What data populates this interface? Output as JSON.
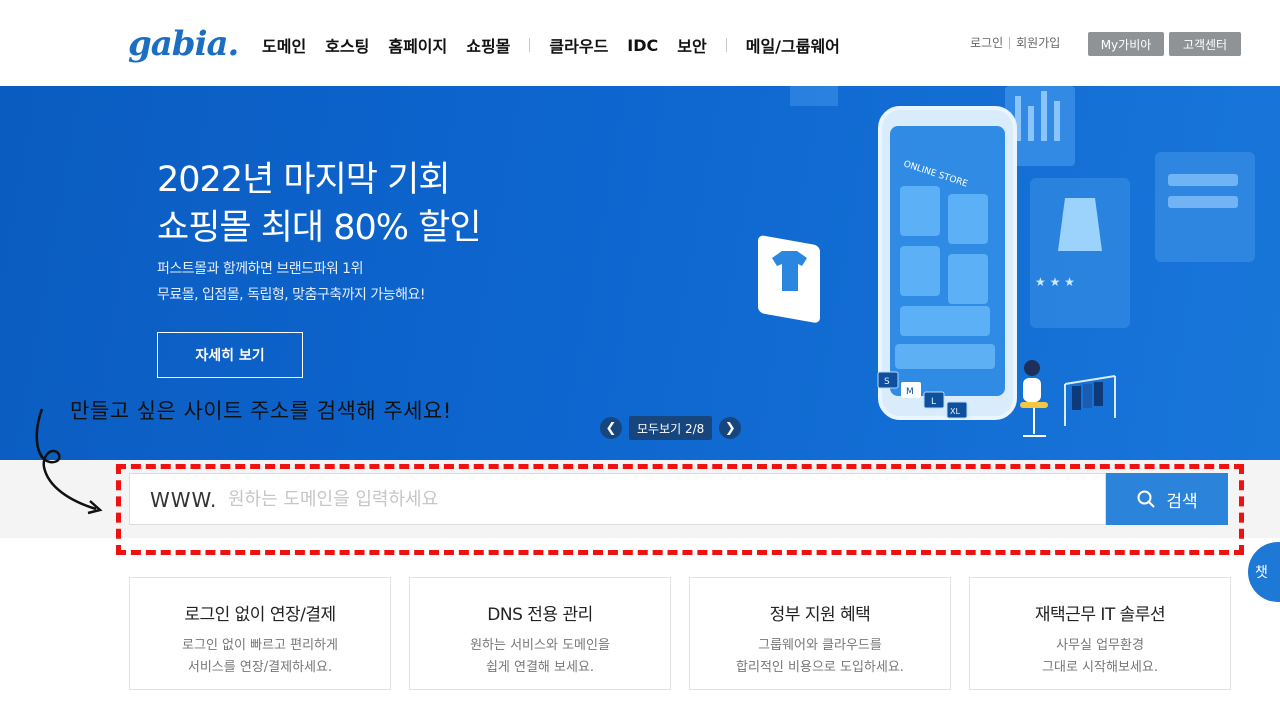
{
  "header": {
    "logo": "gabia.",
    "nav": [
      "도메인",
      "호스팅",
      "홈페이지",
      "쇼핑몰",
      "클라우드",
      "IDC",
      "보안",
      "메일/그룹웨어"
    ],
    "login": "로그인",
    "signup": "회원가입",
    "mygabia": "My가비아",
    "support": "고객센터"
  },
  "banner": {
    "title_line1": "2022년 마지막 기회",
    "title_line2": "쇼핑몰 최대 80% 할인",
    "desc_line1": "퍼스트몰과 함께하면 브랜드파워 1위",
    "desc_line2": "무료몰, 입점몰, 독립형, 맞춤구축까지 가능해요!",
    "button": "자세히 보기",
    "pager_label": "모두보기 2/8",
    "screen_text": "ONLINE STORE",
    "sizes": [
      "S",
      "M",
      "L",
      "XL"
    ]
  },
  "annotation": {
    "text": "만들고 싶은 사이트 주소를 검색해 주세요!"
  },
  "search": {
    "prefix": "WWW.",
    "placeholder": "원하는 도메인을 입력하세요",
    "button": "검색"
  },
  "chat": {
    "label": "챗"
  },
  "cards": [
    {
      "title": "로그인 없이 연장/결제",
      "line1": "로그인 없이 빠르고 편리하게",
      "line2": "서비스를 연장/결제하세요."
    },
    {
      "title": "DNS 전용 관리",
      "line1": "원하는 서비스와 도메인을",
      "line2": "쉽게 연결해 보세요."
    },
    {
      "title": "정부 지원 혜택",
      "line1": "그룹웨어와 클라우드를",
      "line2": "합리적인 비용으로 도입하세요."
    },
    {
      "title": "재택근무 IT 솔루션",
      "line1": "사무실 업무환경",
      "line2": "그대로 시작해보세요."
    }
  ],
  "colors": {
    "brand": "#1b6ec2",
    "banner": "#0d66cf",
    "search_button": "#2b84d9",
    "highlight": "#ee1111"
  }
}
